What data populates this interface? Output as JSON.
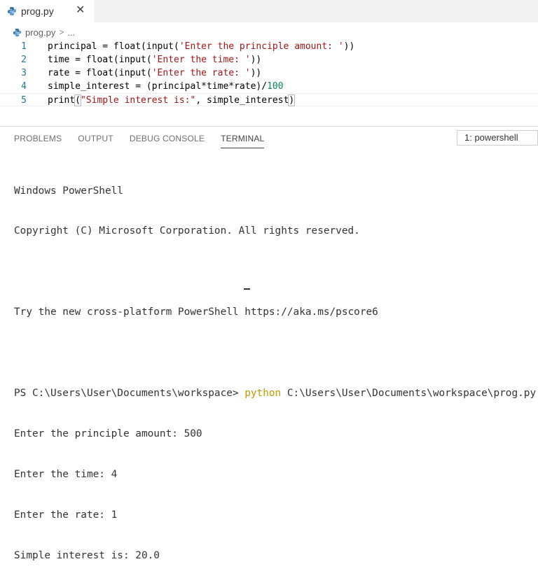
{
  "tab": {
    "title": "prog.py",
    "close": "✕"
  },
  "breadcrumb": {
    "file": "prog.py",
    "rest": "..."
  },
  "editor": {
    "line_numbers": [
      "1",
      "2",
      "3",
      "4",
      "5"
    ],
    "lines": [
      {
        "a": "principal = float(input(",
        "s": "'Enter the principle amount: '",
        "b": "))"
      },
      {
        "a": "time = float(input(",
        "s": "'Enter the time: '",
        "b": "))"
      },
      {
        "a": "rate = float(input(",
        "s": "'Enter the rate: '",
        "b": "))"
      },
      {
        "a": "simple_interest = (principal*time*rate)/",
        "n": "100"
      },
      {
        "a": "print",
        "p1": "(",
        "s": "\"Simple interest is:\"",
        "b": ", simple_interest",
        "p2": ")"
      }
    ]
  },
  "panel": {
    "tabs": [
      "PROBLEMS",
      "OUTPUT",
      "DEBUG CONSOLE",
      "TERMINAL"
    ],
    "active_tab": "TERMINAL",
    "terminal_select": "1: powershell"
  },
  "terminal": {
    "line1": "Windows PowerShell",
    "line2": "Copyright (C) Microsoft Corporation. All rights reserved.",
    "line3": "Try the new cross-platform PowerShell https://aka.ms/pscore6",
    "prompt": "PS C:\\Users\\User\\Documents\\workspace> ",
    "command": "python",
    "args": " C:\\Users\\User\\Documents\\workspace\\prog.py",
    "out1": "Enter the principle amount: 500",
    "out2": "Enter the time: 4",
    "out3": "Enter the rate: 1",
    "out4": "Simple interest is: 20.0"
  },
  "colors": {
    "accent": "#237893",
    "string": "#a31515",
    "number": "#098658",
    "command": "#c19c00"
  }
}
